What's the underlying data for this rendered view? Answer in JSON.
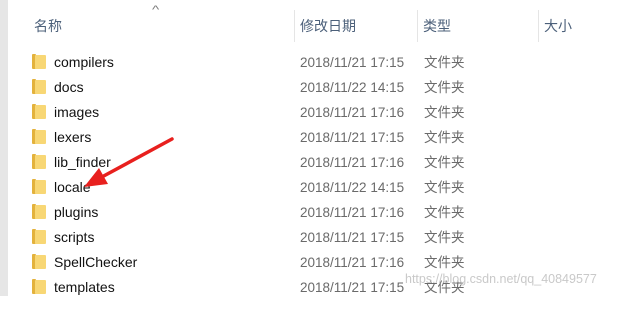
{
  "columns": {
    "name": "名称",
    "date": "修改日期",
    "type": "类型",
    "size": "大小"
  },
  "sort_indicator": "^",
  "files": [
    {
      "name": "compilers",
      "date": "2018/11/21 17:15",
      "type": "文件夹"
    },
    {
      "name": "docs",
      "date": "2018/11/22 14:15",
      "type": "文件夹"
    },
    {
      "name": "images",
      "date": "2018/11/21 17:16",
      "type": "文件夹"
    },
    {
      "name": "lexers",
      "date": "2018/11/21 17:15",
      "type": "文件夹"
    },
    {
      "name": "lib_finder",
      "date": "2018/11/21 17:16",
      "type": "文件夹"
    },
    {
      "name": "locale",
      "date": "2018/11/22 14:15",
      "type": "文件夹"
    },
    {
      "name": "plugins",
      "date": "2018/11/21 17:16",
      "type": "文件夹"
    },
    {
      "name": "scripts",
      "date": "2018/11/21 17:15",
      "type": "文件夹"
    },
    {
      "name": "SpellChecker",
      "date": "2018/11/21 17:16",
      "type": "文件夹"
    },
    {
      "name": "templates",
      "date": "2018/11/21 17:15",
      "type": "文件夹"
    }
  ],
  "watermark": "https://blog.csdn.net/qq_40849577",
  "colors": {
    "folder_body": "#f8d775",
    "folder_edge": "#e3b23c",
    "arrow": "#e8201e",
    "header_text": "#4c607a"
  }
}
